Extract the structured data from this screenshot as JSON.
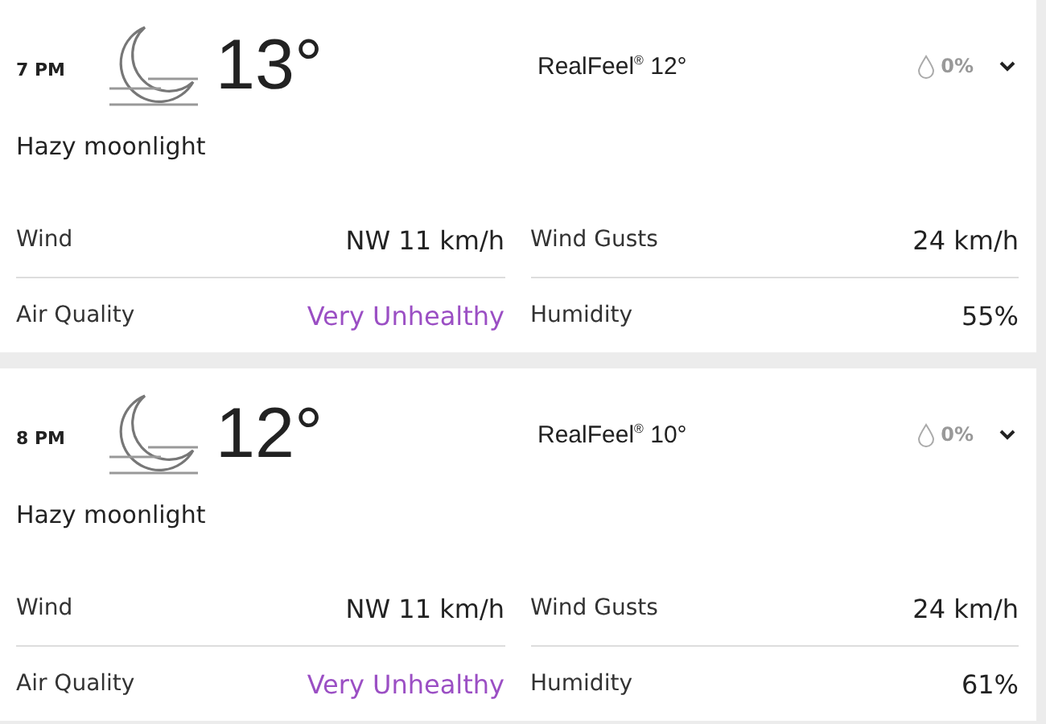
{
  "hours": [
    {
      "time": "7 PM",
      "temperature": "13°",
      "realfeel_label": "RealFeel",
      "realfeel_mark": "®",
      "realfeel_value": "12°",
      "precipitation": "0%",
      "condition": "Hazy moonlight",
      "expanded": false,
      "stats": [
        {
          "label": "Wind",
          "value": "NW 11 km/h"
        },
        {
          "label": "Wind Gusts",
          "value": "24 km/h"
        },
        {
          "label": "Air Quality",
          "value": "Very Unhealthy",
          "color": "#9b4fc4"
        },
        {
          "label": "Humidity",
          "value": "55%"
        }
      ]
    },
    {
      "time": "8 PM",
      "temperature": "12°",
      "realfeel_label": "RealFeel",
      "realfeel_mark": "®",
      "realfeel_value": "10°",
      "precipitation": "0%",
      "condition": "Hazy moonlight",
      "expanded": false,
      "stats": [
        {
          "label": "Wind",
          "value": "NW 11 km/h"
        },
        {
          "label": "Wind Gusts",
          "value": "24 km/h"
        },
        {
          "label": "Air Quality",
          "value": "Very Unhealthy",
          "color": "#9b4fc4"
        },
        {
          "label": "Humidity",
          "value": "61%"
        }
      ]
    }
  ]
}
